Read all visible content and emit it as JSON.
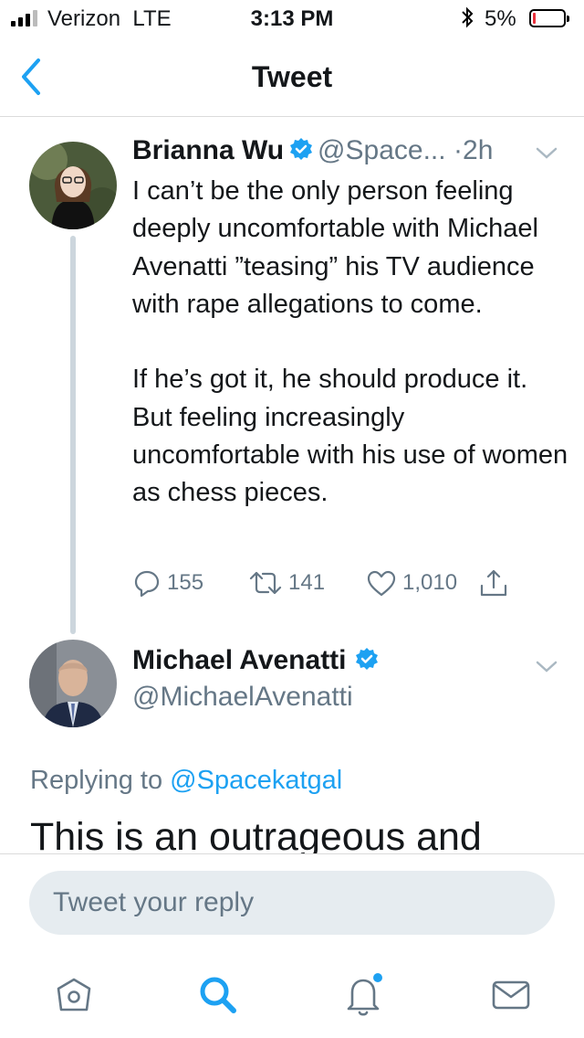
{
  "status_bar": {
    "carrier": "Verizon",
    "network": "LTE",
    "time": "3:13 PM",
    "battery_percent": "5%",
    "battery_level": 0.05
  },
  "nav": {
    "title": "Tweet"
  },
  "tweet": {
    "name": "Brianna Wu",
    "handle": "@Space...",
    "time": "·2h",
    "paragraphs": [
      "I can’t be the only person feeling deeply uncomfortable with Michael Avenatti ”teasing” his TV audience with rape allegations to come.",
      "If he’s got it, he should produce it. But feeling increasingly uncomfortable with his use of women as chess pieces."
    ],
    "replies": "155",
    "retweets": "141",
    "likes": "1,010"
  },
  "reply": {
    "name": "Michael Avenatti",
    "handle": "@MichaelAvenatti",
    "replying_to_label": "Replying to",
    "replying_to_handle": "@Spacekatgal",
    "text": "This is an outrageous and"
  },
  "composer": {
    "placeholder": "Tweet your reply"
  },
  "tabs": [
    {
      "icon": "home-icon"
    },
    {
      "icon": "search-icon"
    },
    {
      "icon": "notifications-bell-icon"
    },
    {
      "icon": "messages-envelope-icon"
    }
  ],
  "colors": {
    "accent": "#1da1f2",
    "muted": "#657786",
    "thread": "#ccd6dd"
  }
}
